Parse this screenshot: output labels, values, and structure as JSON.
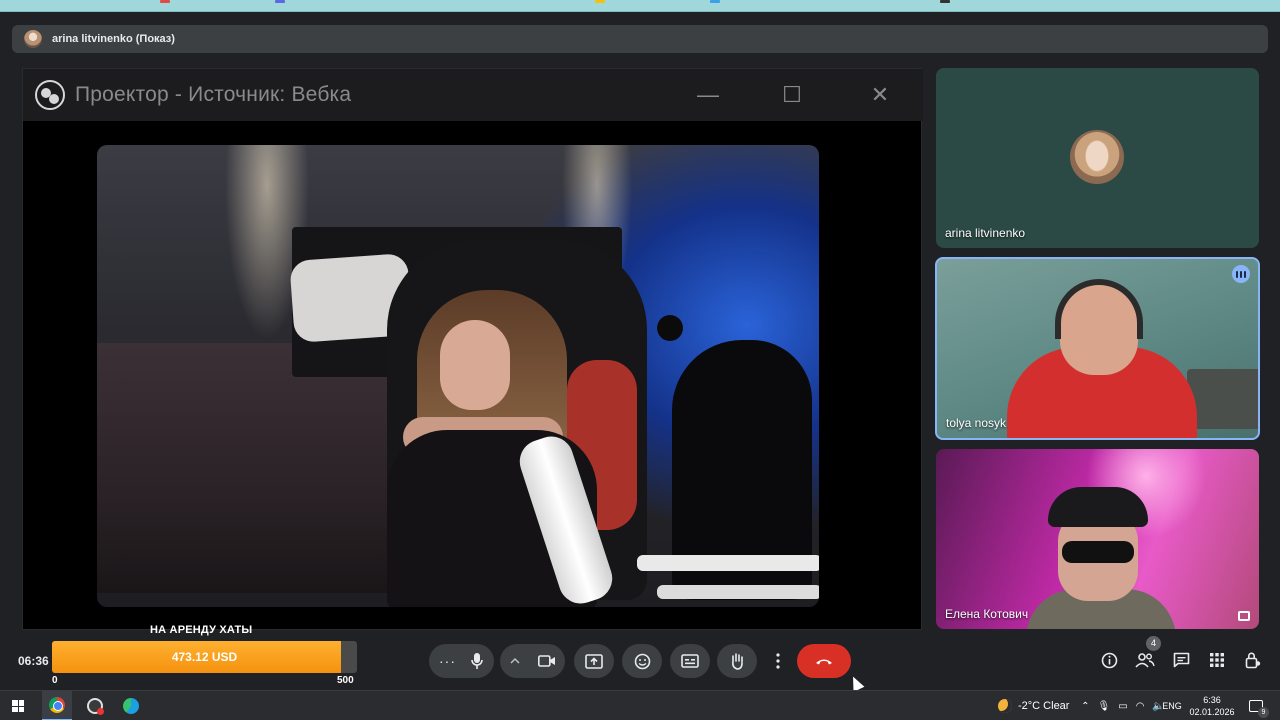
{
  "presenter_bar": {
    "label": "arina litvinenko (Показ)"
  },
  "obs_window": {
    "title": "Проектор - Источник: Вебка",
    "minimize_glyph": "—",
    "maximize_glyph": "☐",
    "close_glyph": "✕"
  },
  "tiles": [
    {
      "name": "arina litvinenko"
    },
    {
      "name": "tolya nosyk"
    },
    {
      "name": "Елена Котович"
    }
  ],
  "donation": {
    "title": "НА АРЕНДУ ХАТЫ",
    "value": "473.12 USD",
    "min_label": "0",
    "max_label": "500",
    "progress_fraction": 0.946
  },
  "meeting": {
    "time": "06:36",
    "people_count": "4"
  },
  "controls": {
    "more_options": "more-options-icon",
    "mic": "mic-icon",
    "camera": "camera-icon",
    "present": "present-icon",
    "emoji": "emoji-icon",
    "captions": "captions-icon",
    "raise_hand": "hand-icon",
    "menu": "vertical-dots-icon",
    "hangup": "hangup-icon"
  },
  "taskbar": {
    "weather": "-2°C  Clear",
    "lang": "ENG",
    "time": "6:36",
    "date": "02.01.2026",
    "notifications": "9"
  },
  "colors": {
    "meet_bg": "#202124",
    "hangup_red": "#d93025",
    "active_speaker": "#8ab4f8",
    "donation_fill": "#f4920f"
  }
}
